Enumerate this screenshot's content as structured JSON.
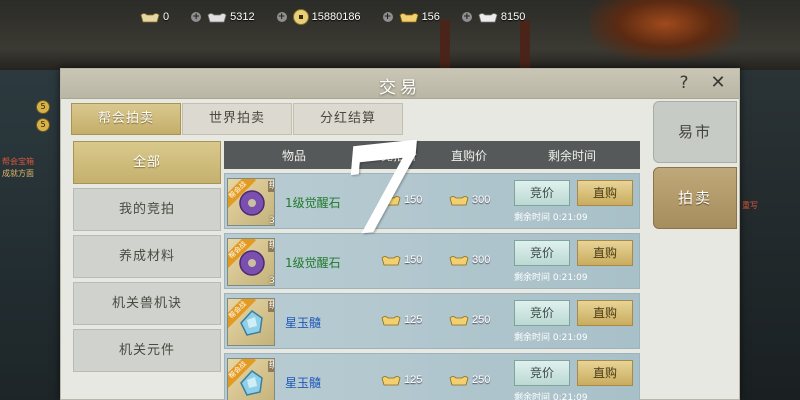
{
  "background": {
    "left_labels": [
      "帮会宝箱",
      "成就方面",
      "成就方面",
      "成就方面"
    ],
    "right_labels": [
      "重写"
    ]
  },
  "currency_bar": [
    {
      "icon": "silver-ingot-icon",
      "value": "0"
    },
    {
      "icon": "silver-ingot-icon",
      "value": "5312"
    },
    {
      "icon": "copper-coin-icon",
      "value": "15880186"
    },
    {
      "icon": "gold-ingot-icon",
      "value": "156"
    },
    {
      "icon": "silver-ingot-icon",
      "value": "8150"
    }
  ],
  "window": {
    "title": "交易",
    "help_label": "?",
    "close_label": "✕"
  },
  "top_tabs": [
    {
      "label": "帮会拍卖",
      "active": true
    },
    {
      "label": "世界拍卖",
      "active": false
    },
    {
      "label": "分红结算",
      "active": false
    }
  ],
  "side_menu": [
    {
      "label": "全部",
      "active": true
    },
    {
      "label": "我的竞拍",
      "active": false
    },
    {
      "label": "养成材料",
      "active": false
    },
    {
      "label": "机关兽机诀",
      "active": false
    },
    {
      "label": "机关元件",
      "active": false
    }
  ],
  "right_tabs": [
    {
      "label": "易市",
      "active": false
    },
    {
      "label": "拍卖",
      "active": true
    }
  ],
  "table": {
    "headers": [
      "物品",
      "竞拍价",
      "直购价",
      "剩余时间"
    ],
    "rows": [
      {
        "ribbon": "帮会战",
        "bind": "绑",
        "qty": "3",
        "name": "1级觉醒石",
        "gem": "purple",
        "bid_price": "150",
        "buy_price": "300",
        "bid_label": "竞价",
        "buy_label": "直购",
        "remain": "剩余时间 0:21:09"
      },
      {
        "ribbon": "帮会战",
        "bind": "绑",
        "qty": "3",
        "name": "1级觉醒石",
        "gem": "purple",
        "bid_price": "150",
        "buy_price": "300",
        "bid_label": "竞价",
        "buy_label": "直购",
        "remain": "剩余时间 0:21:09"
      },
      {
        "ribbon": "帮会战",
        "bind": "绑",
        "qty": "",
        "name": "星玉髓",
        "gem": "blue",
        "bid_price": "125",
        "buy_price": "250",
        "bid_label": "竞价",
        "buy_label": "直购",
        "remain": "剩余时间 0:21:09"
      },
      {
        "ribbon": "帮会战",
        "bind": "绑",
        "qty": "",
        "name": "星玉髓",
        "gem": "blue",
        "bid_price": "125",
        "buy_price": "250",
        "bid_label": "竞价",
        "buy_label": "直购",
        "remain": "剩余时间 0:21:09"
      }
    ]
  },
  "overlay_numeral": "7",
  "colors": {
    "gold_accent": "#c4ae6a",
    "row_bg": "#b9ccd3",
    "item_green": "#1f7a2a",
    "item_blue": "#1f58b8"
  }
}
